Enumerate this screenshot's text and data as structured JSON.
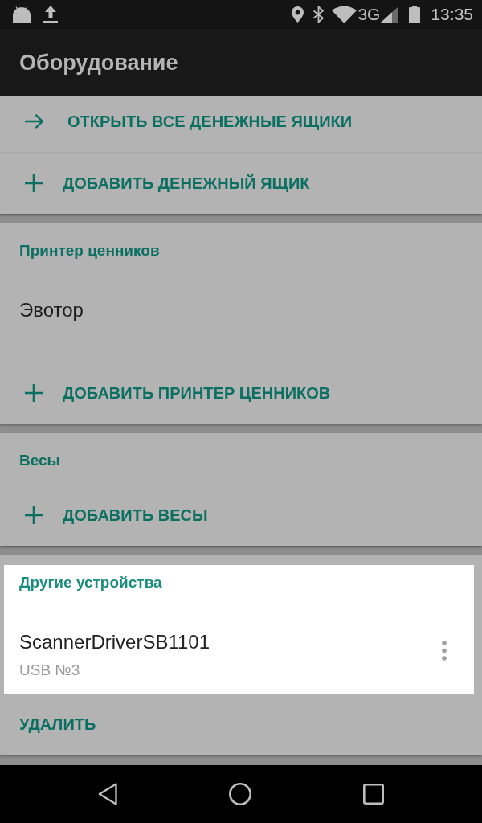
{
  "status_bar": {
    "network": "3G",
    "time": "13:35"
  },
  "app_bar": {
    "title": "Оборудование"
  },
  "sections": [
    {
      "highlighted": false,
      "actions": [
        {
          "kind": "open",
          "label": "ОТКРЫТЬ ВСЕ ДЕНЕЖНЫЕ ЯЩИКИ"
        },
        {
          "kind": "add",
          "label": "ДОБАВИТЬ ДЕНЕЖНЫЙ ЯЩИК"
        }
      ]
    },
    {
      "title": "Принтер ценников",
      "highlighted": false,
      "devices": [
        {
          "name": "Эвотор",
          "menu": false
        }
      ],
      "actions": [
        {
          "kind": "add",
          "label": "ДОБАВИТЬ ПРИНТЕР ЦЕННИКОВ"
        }
      ]
    },
    {
      "title": "Весы",
      "highlighted": false,
      "actions": [
        {
          "kind": "add",
          "label": "ДОБАВИТЬ ВЕСЫ"
        }
      ]
    },
    {
      "title": "Другие устройства",
      "highlighted": true,
      "devices": [
        {
          "name": "ScannerDriverSB1101",
          "detail": "USB №3",
          "menu": true
        }
      ],
      "actions": [
        {
          "kind": "delete",
          "label": "УДАЛИТЬ"
        }
      ]
    }
  ]
}
